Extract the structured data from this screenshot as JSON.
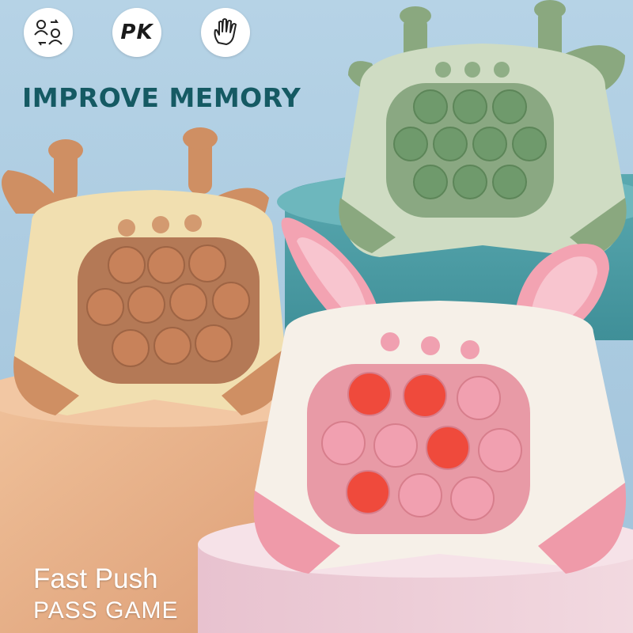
{
  "badges": [
    {
      "icon": "swap-people-icon"
    },
    {
      "label": "PK"
    },
    {
      "icon": "hand-icon"
    }
  ],
  "headline": "IMPROVE MEMORY",
  "caption": {
    "line1": "Fast Push",
    "line2": "PASS GAME"
  },
  "products": [
    {
      "name": "brown-giraffe",
      "body_color": "#f1dfb0",
      "accent_color": "#c98a5f",
      "bubble_color": "#c8825a"
    },
    {
      "name": "green-deer",
      "body_color": "#cfdcc3",
      "accent_color": "#8ba882",
      "bubble_color": "#6f9a6c"
    },
    {
      "name": "pink-bunny",
      "body_color": "#f6f0e8",
      "accent_color": "#ef9aa9",
      "bubble_color": "#f1a0b0",
      "lit_color": "#ef4a3c"
    }
  ],
  "colors": {
    "sky": "#a9c9df",
    "teal_pedestal": "#4e9fa7",
    "peach_pedestal": "#e7b08a",
    "headline": "#155a63"
  }
}
